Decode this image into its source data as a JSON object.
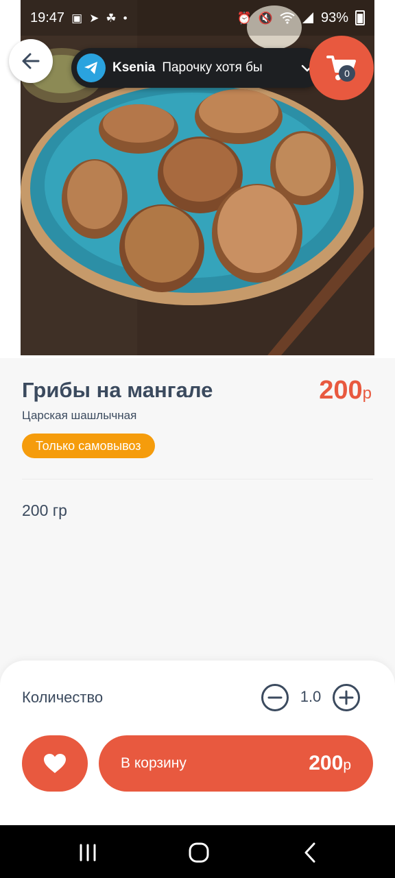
{
  "status_bar": {
    "time": "19:47",
    "battery": "93%",
    "left_icons": [
      "gallery-icon",
      "telegram-icon",
      "app-icon",
      "dot-icon"
    ],
    "right_icons": [
      "alarm-icon",
      "mute-icon",
      "wifi-icon",
      "signal-icon",
      "battery-icon"
    ]
  },
  "notification": {
    "app": "Telegram",
    "sender": "Ksenia",
    "text": "Парочку хотя бы"
  },
  "cart": {
    "count": "0"
  },
  "product": {
    "title": "Грибы на мангале",
    "price": "200",
    "currency": "р",
    "restaurant": "Царская шашлычная",
    "pickup_badge": "Только самовывоз",
    "portion": "200 гр"
  },
  "quantity": {
    "label": "Количество",
    "value": "1.0"
  },
  "add_to_cart": {
    "label": "В корзину",
    "price": "200",
    "currency": "р"
  },
  "colors": {
    "accent": "#e8593f",
    "badge": "#f59c0c",
    "text": "#3b4a5e",
    "telegram": "#2aa3df"
  }
}
